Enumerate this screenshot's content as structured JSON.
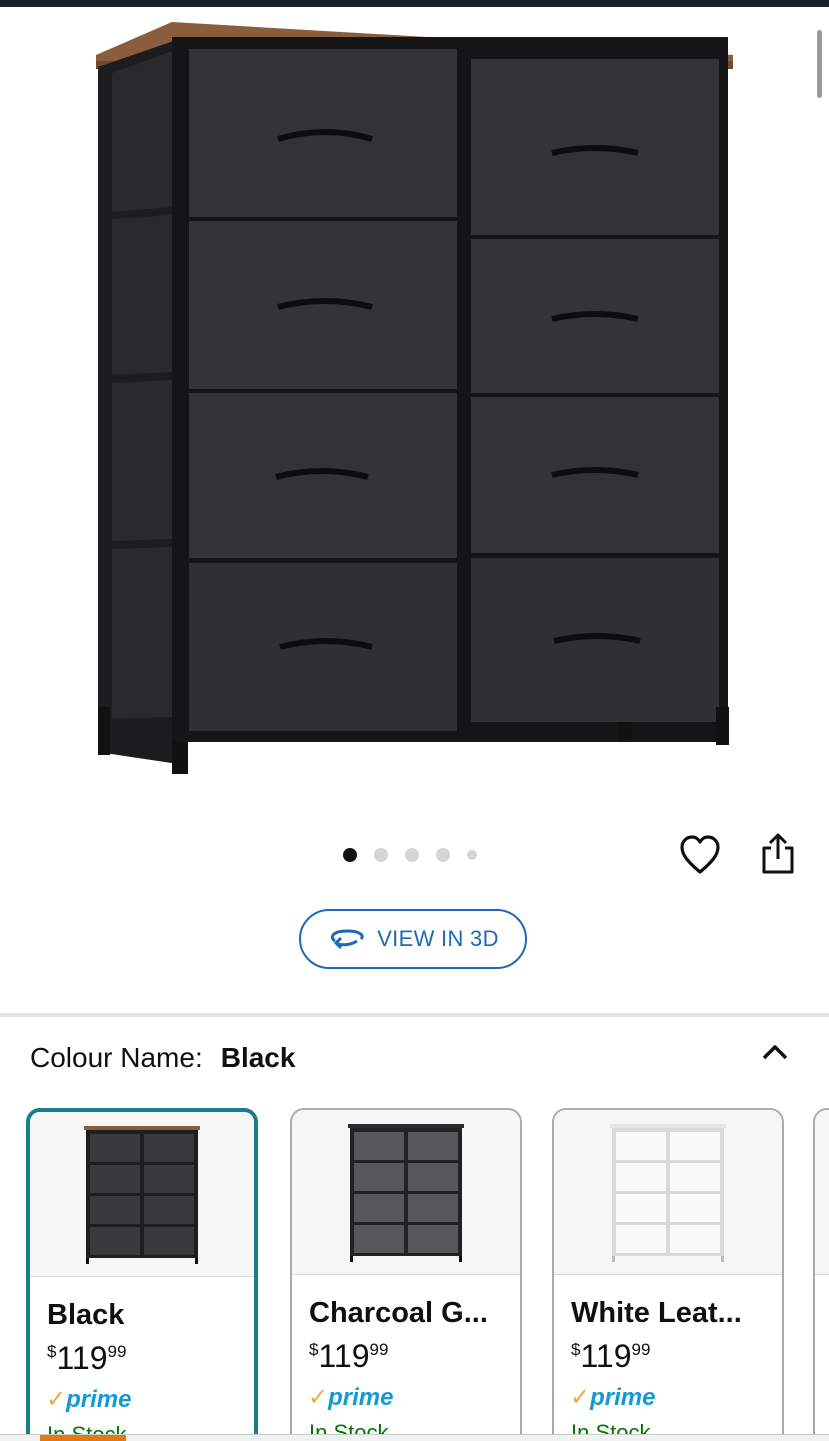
{
  "gallery": {
    "image_alt": "8-drawer fabric dresser with rustic wood top and black steel frame",
    "dots_total": 5,
    "active_dot": 0,
    "favorite_icon": "heart-icon",
    "share_icon": "share-icon"
  },
  "view3d": {
    "label": "VIEW IN 3D",
    "icon": "rotate-3d-icon"
  },
  "colour": {
    "label": "Colour Name:",
    "value": "Black",
    "collapse_icon": "chevron-up-icon"
  },
  "swatches": [
    {
      "name": "Black",
      "price_symbol": "$",
      "price_whole": "119",
      "price_fraction": "99",
      "prime": "prime",
      "stock": "In Stock",
      "color": "#2f2f31",
      "selected": true
    },
    {
      "name": "Charcoal G...",
      "price_symbol": "$",
      "price_whole": "119",
      "price_fraction": "99",
      "prime": "prime",
      "stock": "In Stock",
      "color": "#4a4a4d",
      "selected": false
    },
    {
      "name": "White Leat...",
      "price_symbol": "$",
      "price_whole": "119",
      "price_fraction": "99",
      "prime": "prime",
      "stock": "In Stock",
      "color": "#ffffff",
      "selected": false
    }
  ],
  "colors": {
    "link": "#1e69b5",
    "selected_border": "#1a7d8f",
    "prime_blue": "#1399d4",
    "prime_check": "#f3a847",
    "accent": "#e47911"
  }
}
